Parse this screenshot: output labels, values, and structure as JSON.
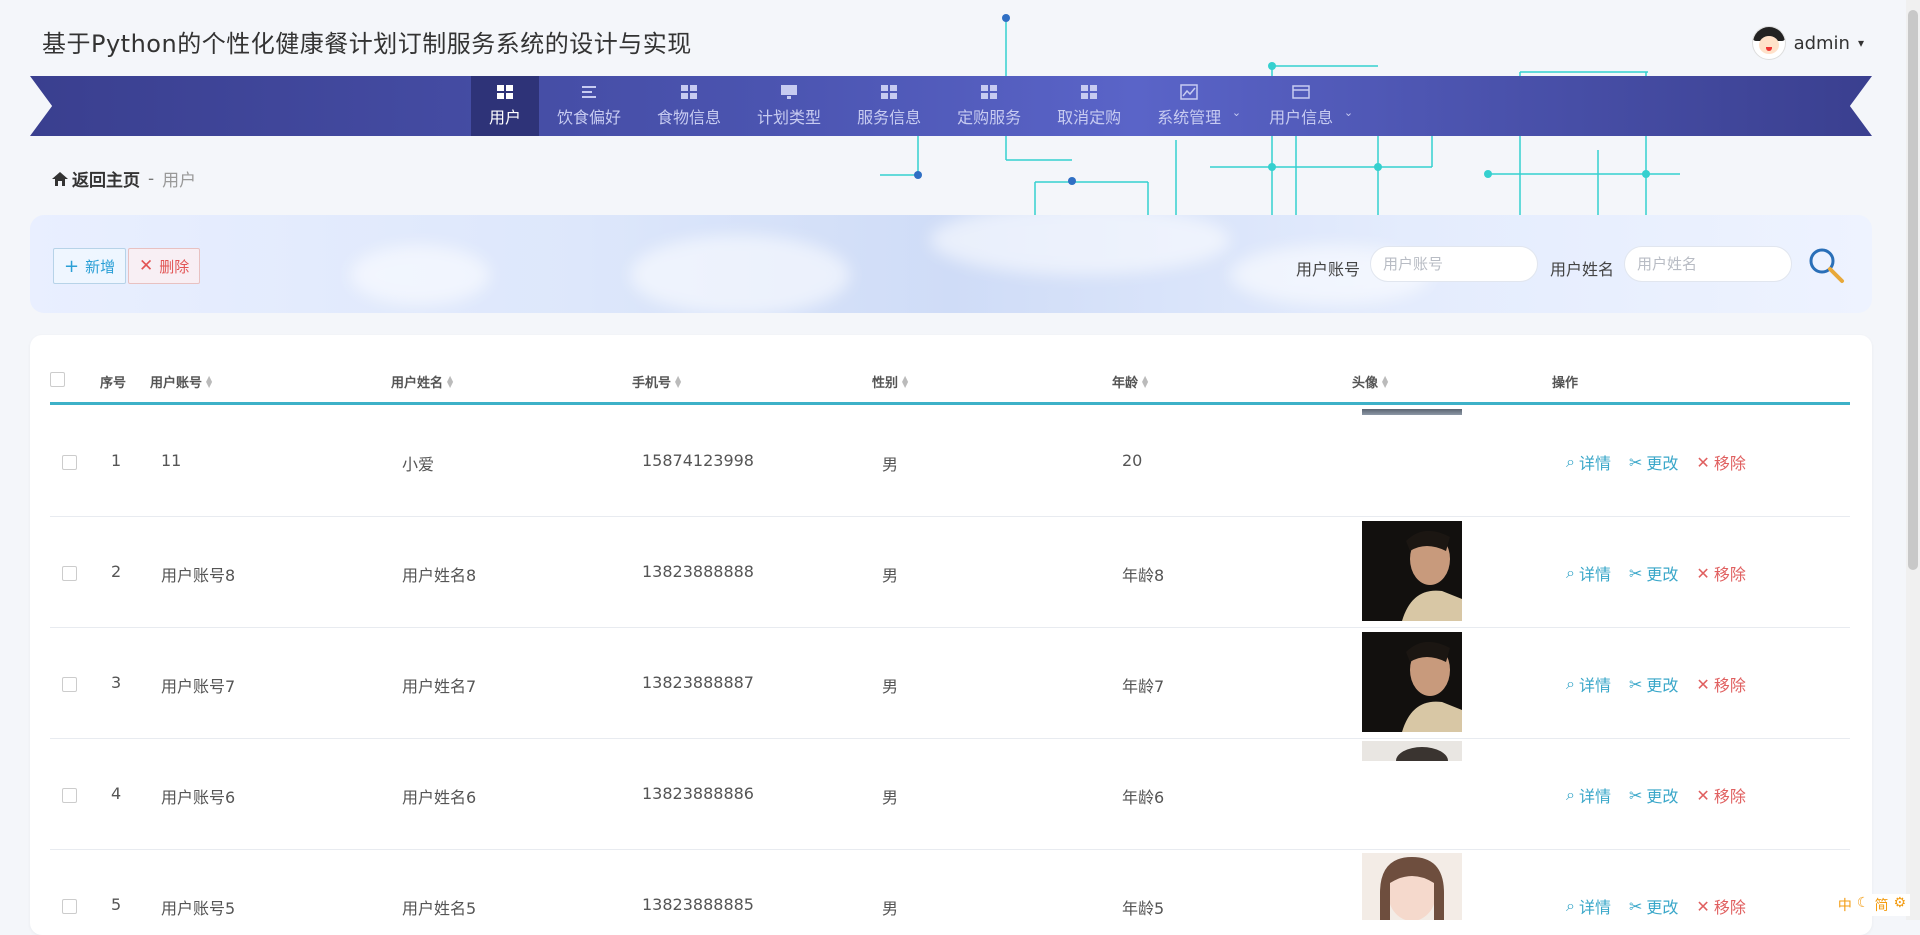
{
  "app": {
    "title": "基于Python的个性化健康餐计划订制服务系统的设计与实现"
  },
  "user": {
    "name": "admin",
    "caret": "▾"
  },
  "nav": {
    "items": [
      {
        "label": "用户",
        "active": true
      },
      {
        "label": "饮食偏好"
      },
      {
        "label": "食物信息"
      },
      {
        "label": "计划类型"
      },
      {
        "label": "服务信息"
      },
      {
        "label": "定购服务"
      },
      {
        "label": "取消定购"
      },
      {
        "label": "系统管理",
        "dropdown": true
      },
      {
        "label": "用户信息",
        "dropdown": true
      }
    ]
  },
  "breadcrumb": {
    "home": "返回主页",
    "sep": "-",
    "current": "用户"
  },
  "toolbar": {
    "add_label": "新增",
    "delete_label": "删除",
    "account_label": "用户账号",
    "account_placeholder": "用户账号",
    "name_label": "用户姓名",
    "name_placeholder": "用户姓名"
  },
  "table": {
    "headers": [
      "序号",
      "用户账号",
      "用户姓名",
      "手机号",
      "性别",
      "年龄",
      "头像",
      "操作"
    ],
    "rows": [
      {
        "no": "1",
        "account": "11",
        "name": "小爱",
        "phone": "15874123998",
        "gender": "男",
        "age": "20",
        "avatar": "partial-top"
      },
      {
        "no": "2",
        "account": "用户账号8",
        "name": "用户姓名8",
        "phone": "13823888888",
        "gender": "男",
        "age": "年龄8",
        "avatar": "man-dark"
      },
      {
        "no": "3",
        "account": "用户账号7",
        "name": "用户姓名7",
        "phone": "13823888887",
        "gender": "男",
        "age": "年龄7",
        "avatar": "man-dark"
      },
      {
        "no": "4",
        "account": "用户账号6",
        "name": "用户姓名6",
        "phone": "13823888886",
        "gender": "男",
        "age": "年龄6",
        "avatar": "partial-light"
      },
      {
        "no": "5",
        "account": "用户账号5",
        "name": "用户姓名5",
        "phone": "13823888885",
        "gender": "男",
        "age": "年龄5",
        "avatar": "girl"
      }
    ],
    "ops": {
      "detail": "详情",
      "edit": "更改",
      "remove": "移除"
    }
  },
  "ime": [
    "中",
    "简"
  ],
  "colors": {
    "nav": "#4b54b0",
    "accent": "#3db1c8",
    "danger": "#e06060",
    "link": "#3aa7c9"
  }
}
